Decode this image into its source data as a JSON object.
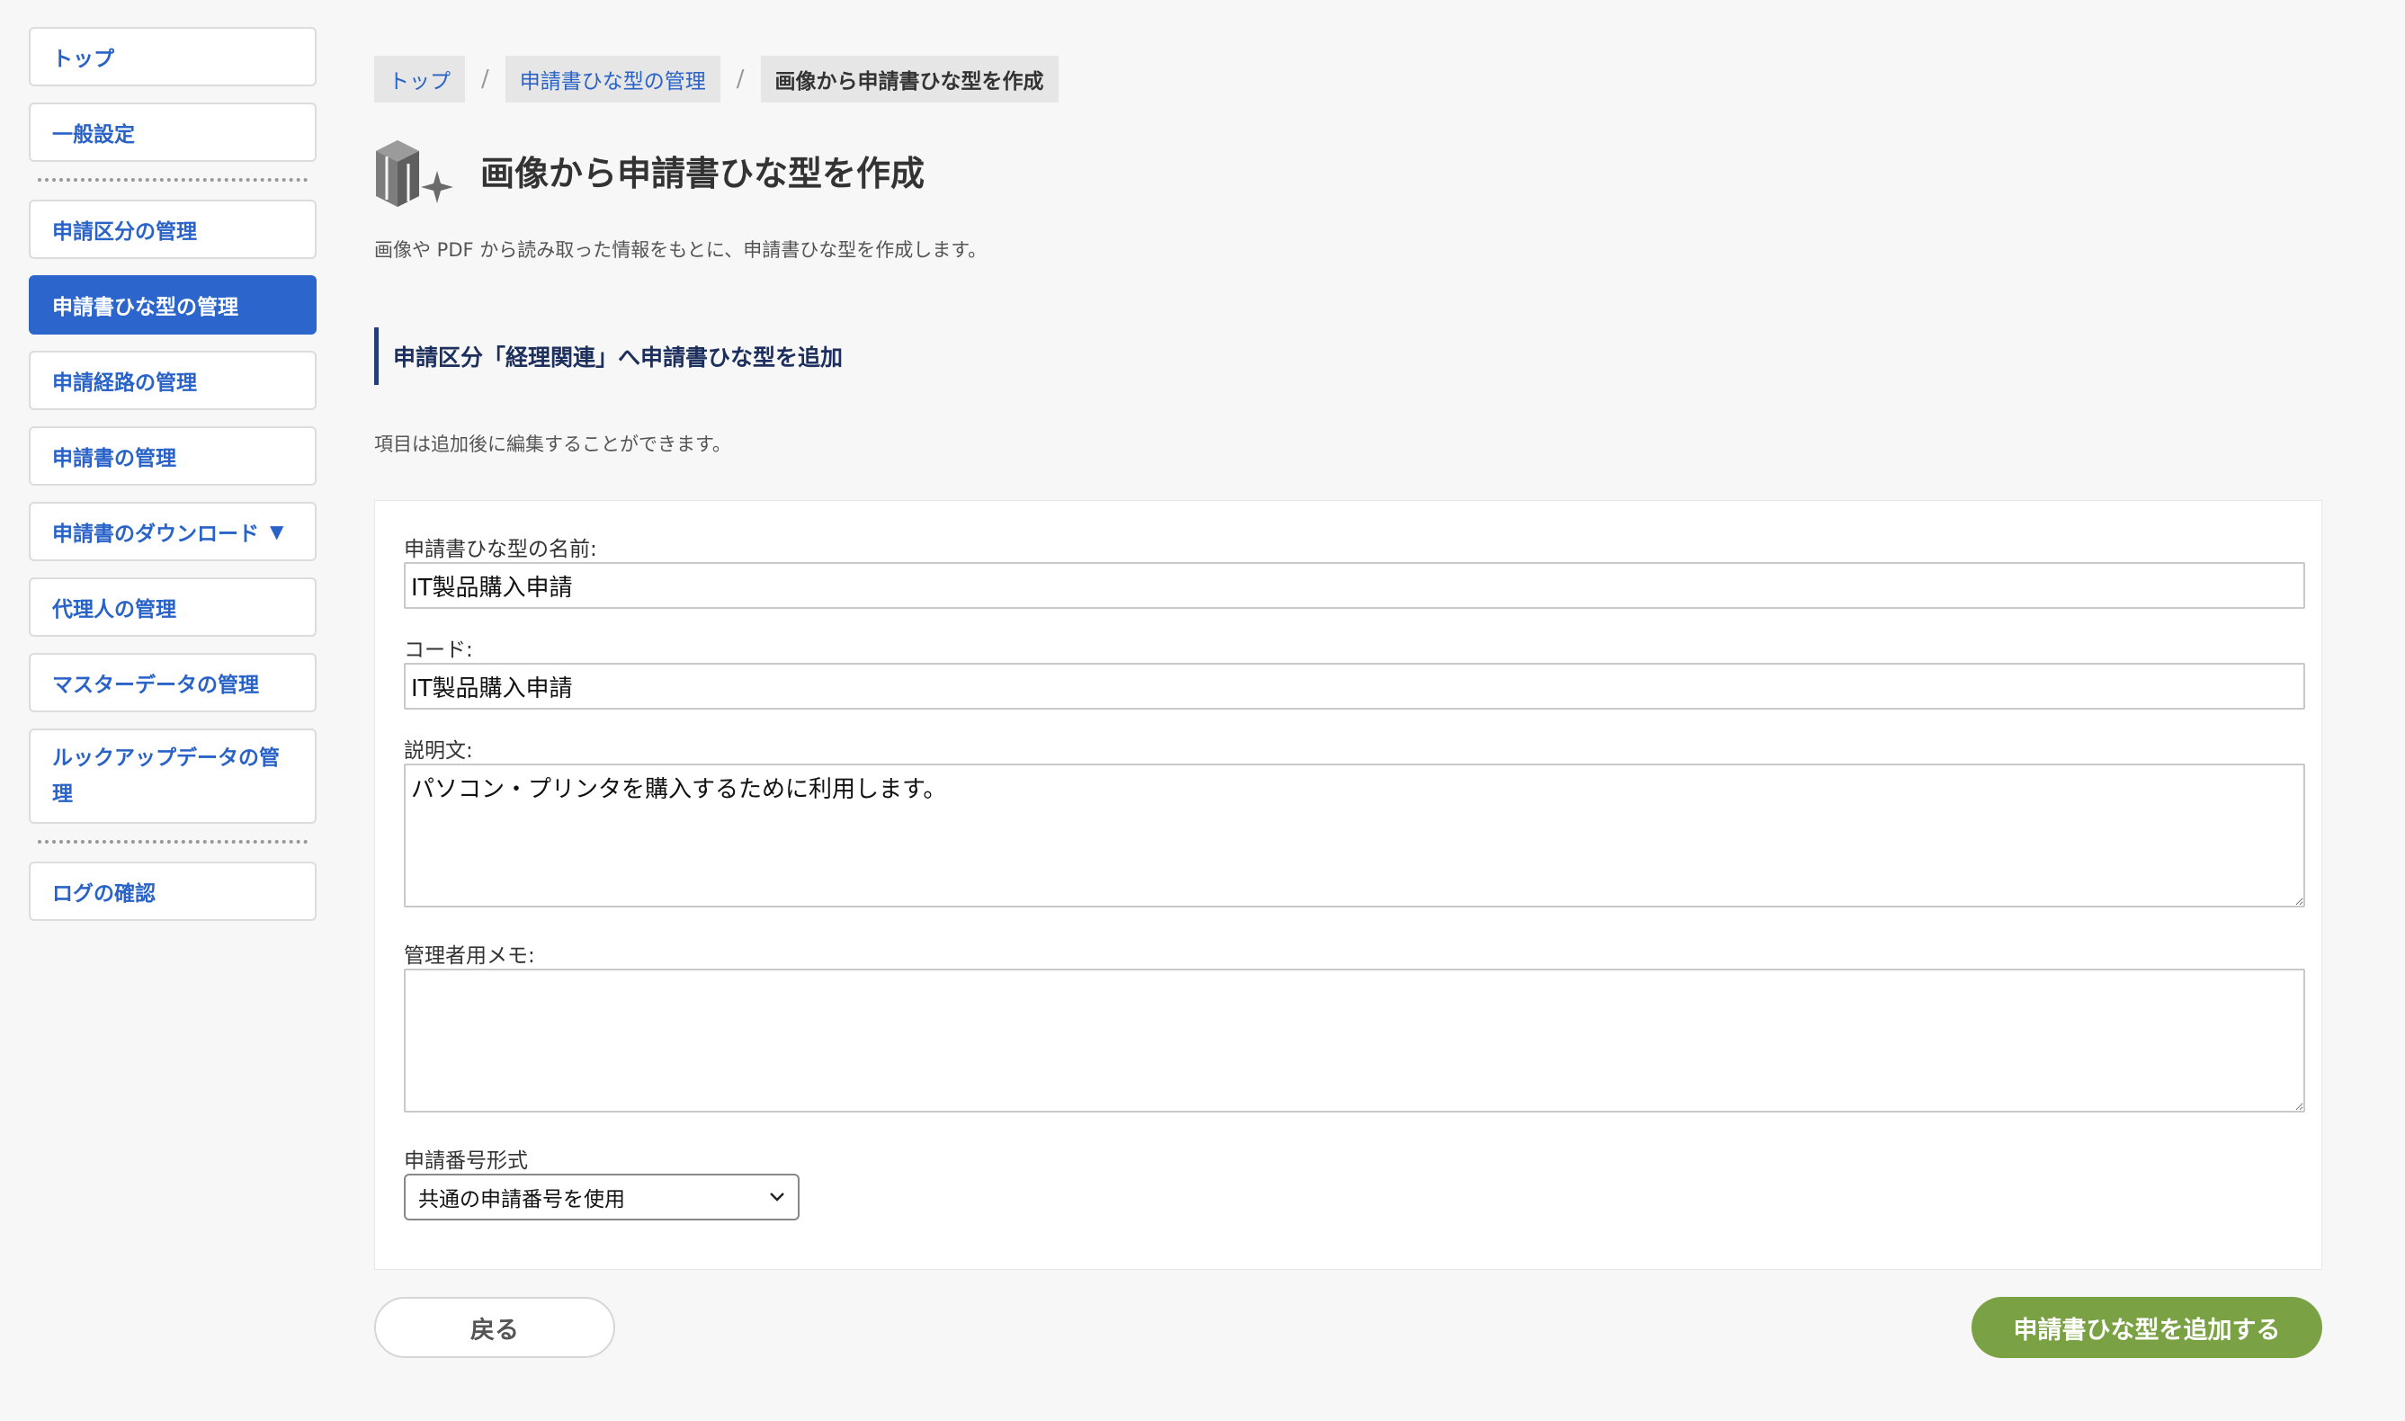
{
  "sidebar": {
    "items": [
      {
        "label": "トップ"
      },
      {
        "label": "一般設定"
      },
      {
        "label": "申請区分の管理"
      },
      {
        "label": "申請書ひな型の管理"
      },
      {
        "label": "申請経路の管理"
      },
      {
        "label": "申請書の管理"
      },
      {
        "label": "申請書のダウンロード",
        "caret": "▼"
      },
      {
        "label": "代理人の管理"
      },
      {
        "label": "マスターデータの管理"
      },
      {
        "label": "ルックアップデータの管理"
      },
      {
        "label": "ログの確認"
      }
    ],
    "active_index": 3
  },
  "breadcrumb": {
    "items": [
      "トップ",
      "申請書ひな型の管理",
      "画像から申請書ひな型を作成"
    ],
    "separator": "/"
  },
  "page": {
    "title": "画像から申請書ひな型を作成",
    "description": "画像や PDF から読み取った情報をもとに、申請書ひな型を作成します。",
    "icon": "ai-template-icon"
  },
  "section": {
    "heading": "申請区分「経理関連」へ申請書ひな型を追加",
    "note": "項目は追加後に編集することができます。"
  },
  "form": {
    "name_label": "申請書ひな型の名前:",
    "name_value": "IT製品購入申請",
    "code_label": "コード:",
    "code_value": "IT製品購入申請",
    "description_label": "説明文:",
    "description_value": "パソコン・プリンタを購入するために利用します。",
    "memo_label": "管理者用メモ:",
    "memo_value": "",
    "number_format_label": "申請番号形式",
    "number_format_selected": "共通の申請番号を使用"
  },
  "buttons": {
    "back": "戻る",
    "submit": "申請書ひな型を追加する"
  },
  "colors": {
    "accent_blue": "#2c66cc",
    "submit_green": "#7aa143",
    "heading_navy": "#1d2f5c"
  }
}
